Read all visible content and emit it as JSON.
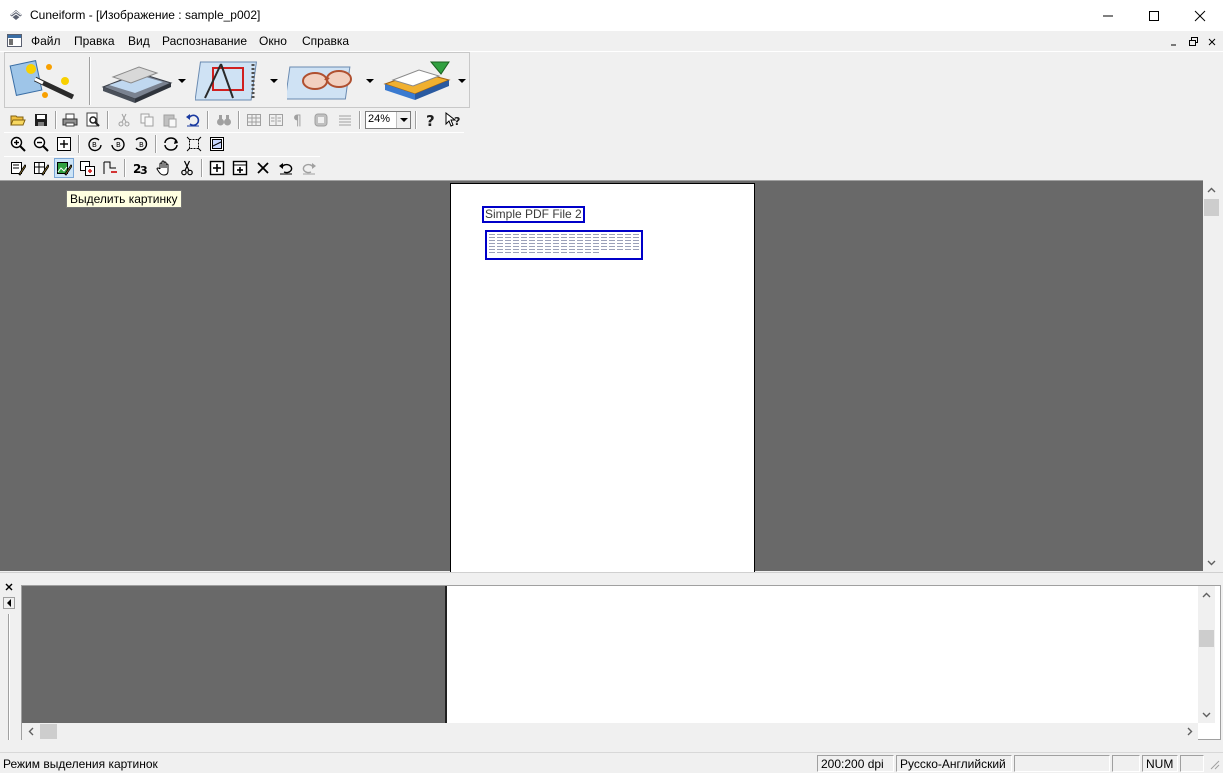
{
  "window": {
    "title": "Cuneiform - [Изображение : sample_p002]",
    "controls": [
      "minimize",
      "maximize",
      "close"
    ]
  },
  "menu": {
    "items": [
      {
        "label": "Файл"
      },
      {
        "label": "Правка"
      },
      {
        "label": "Вид"
      },
      {
        "label": "Распознавание"
      },
      {
        "label": "Окно"
      },
      {
        "label": "Справка"
      }
    ]
  },
  "toolbar_big": {
    "buttons": [
      {
        "icon": "magic-wand-icon",
        "has_dropdown": false
      },
      {
        "icon": "scanner-icon",
        "has_dropdown": true
      },
      {
        "icon": "layout-analysis-icon",
        "has_dropdown": true
      },
      {
        "icon": "recognize-glasses-icon",
        "has_dropdown": true
      },
      {
        "icon": "save-export-icon",
        "has_dropdown": true
      }
    ]
  },
  "toolbar": {
    "zoom_value": "24%"
  },
  "tooltip": {
    "text": "Выделить картинку"
  },
  "image": {
    "title_block_text": "Simple PDF File 2"
  },
  "statusbar": {
    "mode_text": "Режим выделения картинок",
    "dpi": "200:200 dpi",
    "language": "Русско-Английский",
    "num": "NUM"
  },
  "colors": {
    "workspace": "#696969",
    "block_border": "#0000c8",
    "tooltip_bg": "#ffffe1"
  }
}
